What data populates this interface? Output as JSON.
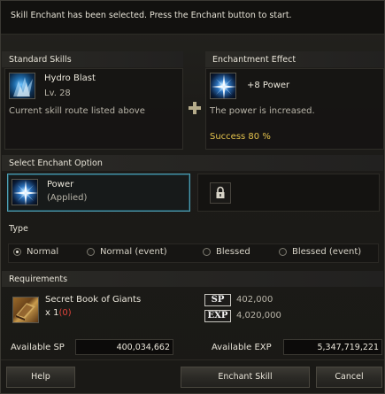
{
  "notice": "Skill Enchant has been selected. Press the Enchant button to start.",
  "standard_skills": {
    "header": "Standard Skills",
    "skill_name": "Hydro Blast",
    "skill_level": "Lv. 28",
    "route_note": "Current skill route listed above"
  },
  "enchantment_effect": {
    "header": "Enchantment Effect",
    "effect_name": "+8 Power",
    "description": "The power is increased.",
    "success_rate": "Success 80 %"
  },
  "select_option": {
    "header": "Select Enchant Option",
    "option_name": "Power",
    "option_state": "(Applied)"
  },
  "type": {
    "header": "Type",
    "options": [
      "Normal",
      "Normal (event)",
      "Blessed",
      "Blessed (event)"
    ],
    "selected": "Normal"
  },
  "requirements": {
    "header": "Requirements",
    "item_name": "Secret Book of Giants",
    "item_qty_prefix": "x 1",
    "item_qty_owned": "(0)",
    "sp_label": "SP",
    "sp_value": "402,000",
    "exp_label": "EXP",
    "exp_value": "4,020,000"
  },
  "available": {
    "sp_label": "Available SP",
    "sp_value": "400,034,662",
    "exp_label": "Available EXP",
    "exp_value": "5,347,719,221"
  },
  "buttons": {
    "help": "Help",
    "enchant": "Enchant Skill",
    "cancel": "Cancel"
  },
  "colors": {
    "accent_gold": "#e4c24c",
    "selection_border": "#4fa0b4",
    "insufficient_red": "#e0443a"
  }
}
